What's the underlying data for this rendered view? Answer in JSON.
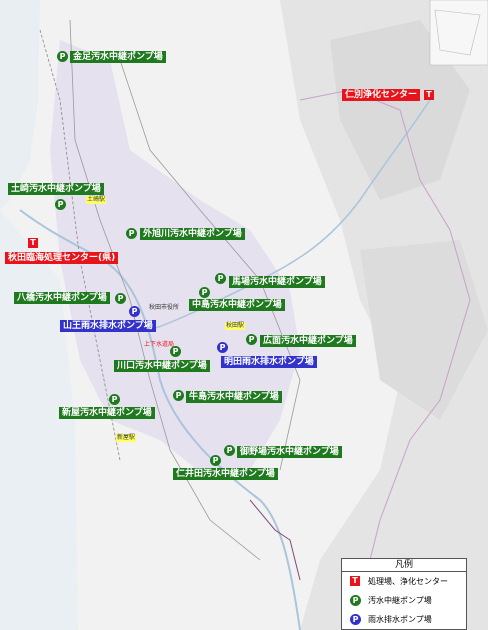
{
  "legend": {
    "title": "凡例",
    "items": [
      {
        "label": "処理場、浄化センター"
      },
      {
        "label": "汚水中継ポンプ場"
      },
      {
        "label": "雨水排水ポンプ場"
      }
    ]
  },
  "icons": {
    "t": "T",
    "p": "P"
  },
  "facilities": {
    "kaneashi": "金足汚水中継ポンプ場",
    "nibetsu": "仁別浄化センター",
    "tsuchizaki": "土崎汚水中継ポンプ場",
    "sotoasahikawa": "外旭川汚水中継ポンプ場",
    "akitarinkai": "秋田臨海処理センター(県)",
    "bajo": "馬場汚水中継ポンプ場",
    "nakajima": "中島汚水中継ポンプ場",
    "hashi": "八橋汚水中継ポンプ場",
    "sannou": "山王雨水排水ポンプ場",
    "hiroomote": "広面汚水中継ポンプ場",
    "kawaguchi": "川口汚水中継ポンプ場",
    "menda": "明田雨水排水ポンプ場",
    "ushijima": "牛島汚水中継ポンプ場",
    "shinya": "新屋汚水中継ポンプ場",
    "goyano": "御野場汚水中継ポンプ場",
    "niida": "仁井田汚水中継ポンプ場"
  },
  "places": {
    "tsuchizaki_sta": "土崎駅",
    "city_office": "秋田市役所",
    "akita_sta": "秋田駅",
    "sewer_bureau": "上下水道局",
    "araya_sta": "新屋駅"
  },
  "colors": {
    "wastewater": "#1f7a1f",
    "stormwater": "#3333cc",
    "treatment": "#e8141b"
  }
}
